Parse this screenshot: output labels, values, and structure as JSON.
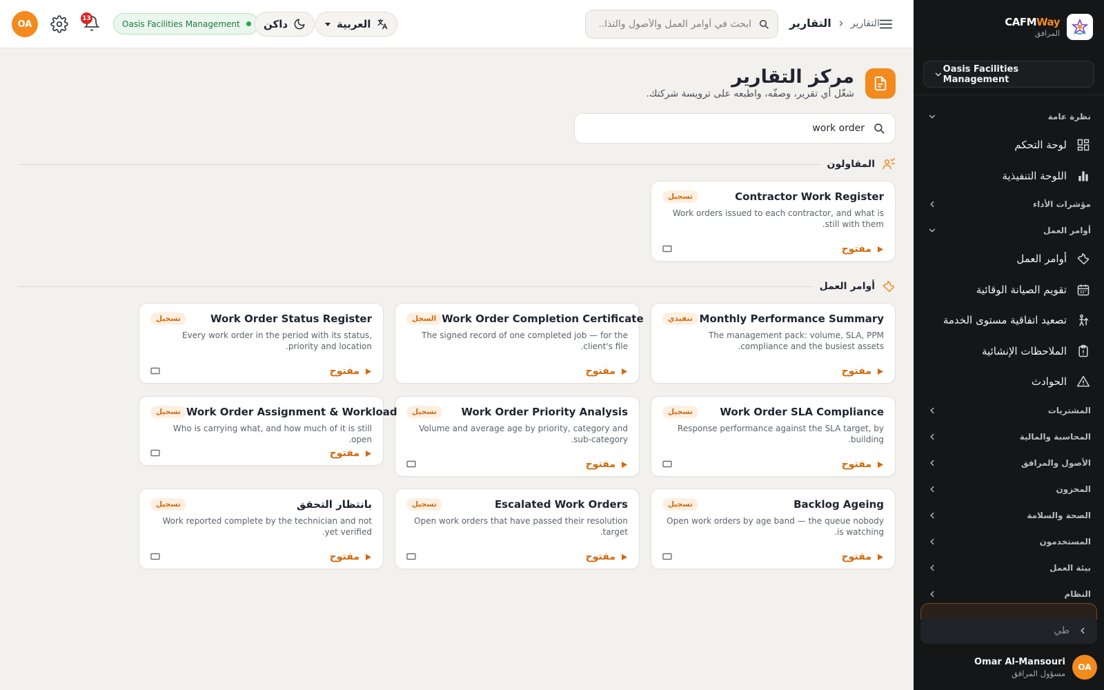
{
  "topbar": {
    "user_initials": "OA",
    "notifications_count": "13",
    "org_chip": "Oasis Facilities Management",
    "theme_label": "داكن",
    "language_label": "العربية",
    "search_placeholder": "ابحث في أوامر العمل والأصول والتذا...",
    "breadcrumb_current": "التقارير",
    "breadcrumb_parent": "التقارير"
  },
  "sidebar": {
    "brand_name_a": "CAFM",
    "brand_name_b": "Way",
    "brand_sub": "المرافق",
    "org_select": "Oasis Facilities Management",
    "nav": {
      "overview": "نظرة عامة",
      "dashboard": "لوحة التحكم",
      "executive": "اللوحة التنفيذية",
      "kpis": "مؤشرات الأداء",
      "work_orders_group": "أوامر العمل",
      "work_orders": "أوامر العمل",
      "ppm_calendar": "تقويم الصيانة الوقائية",
      "sla_escalation": "تصعيد اتفاقية مستوى الخدمة",
      "construction_notes": "الملاحظات الإنشائية",
      "incidents": "الحوادث",
      "procurement": "المشتريات",
      "accounting": "المحاسبة والمالية",
      "assets": "الأصول والمرافق",
      "inventory": "المخزون",
      "hse": "الصحة والسلامة",
      "users": "المستخدمون",
      "workspace": "بيئة العمل",
      "system": "النظام"
    },
    "collapse_label": "طي",
    "user_initials": "OA",
    "user_name": "Omar Al-Mansouri",
    "user_role": "مسؤول المرافق"
  },
  "page": {
    "title": "مركز التقارير",
    "subtitle": "شغّل أي تقرير، وصفّه، واطبعه على ترويسة شركتك.",
    "search_value": "work order",
    "open_label": "مفتوح"
  },
  "sections": {
    "contractors": "المقاولون",
    "work_orders": "أوامر العمل"
  },
  "cards": {
    "contractor_register": {
      "title": "Contractor Work Register",
      "badge": "تسجيل",
      "desc": "Work orders issued to each contractor, and what is still with them."
    },
    "monthly_perf": {
      "title": "Monthly Performance Summary",
      "badge": "تنفيذي",
      "desc": "The management pack: volume, SLA, PPM compliance and the busiest assets."
    },
    "completion_cert": {
      "title": "Work Order Completion Certificate",
      "badge": "السجل",
      "desc": "The signed record of one completed job — for the client's file."
    },
    "status_register": {
      "title": "Work Order Status Register",
      "badge": "تسجيل",
      "desc": "Every work order in the period with its status, priority and location."
    },
    "sla_compliance": {
      "title": "Work Order SLA Compliance",
      "badge": "تسجيل",
      "desc": "Response performance against the SLA target, by building."
    },
    "priority_analysis": {
      "title": "Work Order Priority Analysis",
      "badge": "تسجيل",
      "desc": "Volume and average age by priority, category and sub-category."
    },
    "assignment_workload": {
      "title": "Work Order Assignment & Workload",
      "badge": "تسجيل",
      "desc": "Who is carrying what, and how much of it is still open."
    },
    "backlog_ageing": {
      "title": "Backlog Ageing",
      "badge": "تسجيل",
      "desc": "Open work orders by age band — the queue nobody is watching."
    },
    "escalated": {
      "title": "Escalated Work Orders",
      "badge": "تسجيل",
      "desc": "Open work orders that have passed their resolution target."
    },
    "pending_verification": {
      "title": "بانتظار التحقق",
      "badge": "تسجيل",
      "desc": "Work reported complete by the technician and not yet verified."
    }
  }
}
